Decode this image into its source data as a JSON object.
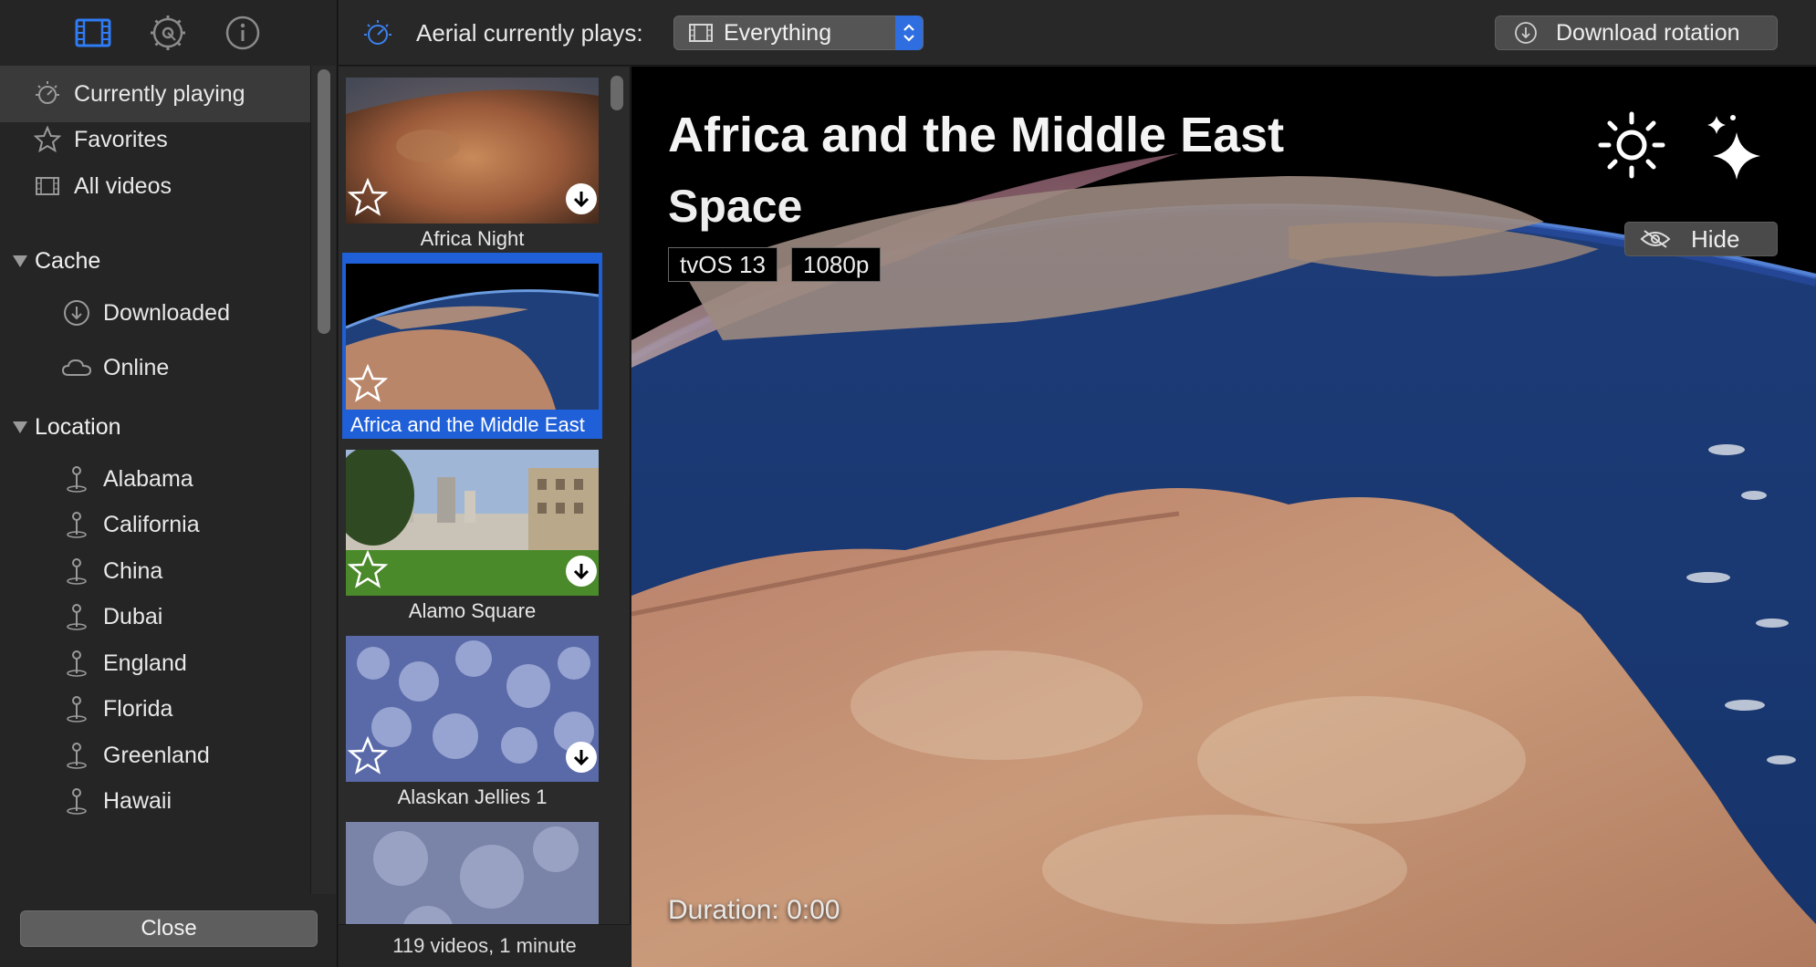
{
  "sidebar": {
    "tabs": [
      {
        "icon": "film-icon",
        "active": true
      },
      {
        "icon": "gear-icon",
        "active": false
      },
      {
        "icon": "info-icon",
        "active": false
      }
    ],
    "items": [
      {
        "label": "Currently playing",
        "icon": "play-rotation-icon"
      },
      {
        "label": "Favorites",
        "icon": "star-icon"
      },
      {
        "label": "All videos",
        "icon": "film-icon"
      }
    ],
    "cache": {
      "heading": "Cache",
      "items": [
        {
          "label": "Downloaded",
          "icon": "download-circle-icon"
        },
        {
          "label": "Online",
          "icon": "cloud-icon"
        }
      ]
    },
    "location": {
      "heading": "Location",
      "items": [
        {
          "label": "Alabama"
        },
        {
          "label": "California"
        },
        {
          "label": "China"
        },
        {
          "label": "Dubai"
        },
        {
          "label": "England"
        },
        {
          "label": "Florida"
        },
        {
          "label": "Greenland"
        },
        {
          "label": "Hawaii"
        }
      ]
    },
    "close_label": "Close"
  },
  "topbar": {
    "label": "Aerial currently plays:",
    "select_value": "Everything",
    "download_label": "Download rotation",
    "accent": "#2f6ee0"
  },
  "videos": {
    "items": [
      {
        "caption": "Africa Night",
        "selected": false,
        "downloadable": true
      },
      {
        "caption": "Africa and the Middle East",
        "selected": true,
        "downloadable": false
      },
      {
        "caption": "Alamo Square",
        "selected": false,
        "downloadable": true
      },
      {
        "caption": "Alaskan Jellies 1",
        "selected": false,
        "downloadable": true
      },
      {
        "caption": "",
        "selected": false,
        "downloadable": false
      }
    ],
    "footer": "119 videos, 1 minute"
  },
  "preview": {
    "title": "Africa and the Middle East",
    "subtitle": "Space",
    "badges": [
      "tvOS 13",
      "1080p"
    ],
    "hide_label": "Hide",
    "duration": "Duration: 0:00"
  }
}
